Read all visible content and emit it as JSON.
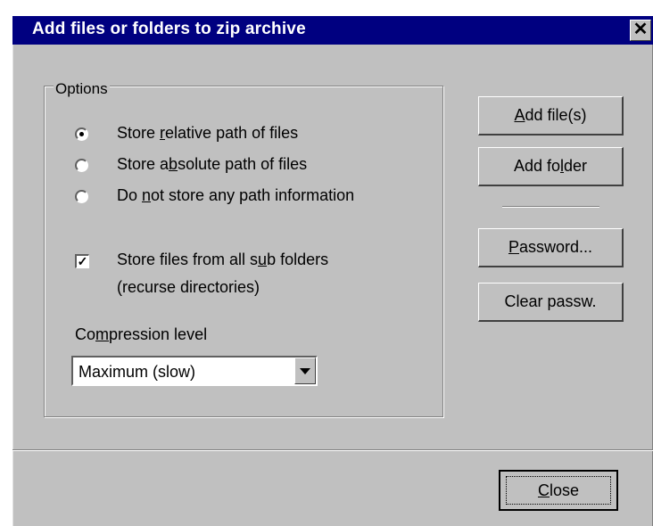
{
  "dialog": {
    "title": "Add files or folders to zip archive",
    "close_glyph": "✕"
  },
  "options": {
    "group_label": "Options",
    "radios": [
      {
        "pre": "Store ",
        "ul": "r",
        "post": "elative path of files",
        "selected": true
      },
      {
        "pre": "Store a",
        "ul": "b",
        "post": "solute path of files",
        "selected": false
      },
      {
        "pre": "Do ",
        "ul": "n",
        "post": "ot store any path information",
        "selected": false
      }
    ],
    "subfolders_checkbox": {
      "line1_pre": "Store files from all s",
      "line1_ul": "u",
      "line1_post": "b folders",
      "line2": "(recurse directories)",
      "checked": true,
      "check_glyph": "✓"
    },
    "compression": {
      "label_pre": "Co",
      "label_ul": "m",
      "label_post": "pression level",
      "selected_value": "Maximum (slow)"
    }
  },
  "buttons": {
    "add_files": {
      "ul": "A",
      "post": "dd file(s)",
      "pre": ""
    },
    "add_folder": {
      "pre": "Add fo",
      "ul": "l",
      "post": "der"
    },
    "password": {
      "pre": "",
      "ul": "P",
      "post": "assword..."
    },
    "clear_password": {
      "label": "Clear passw."
    },
    "close": {
      "pre": "",
      "ul": "C",
      "post": "lose"
    }
  },
  "colors": {
    "titlebar": "#000080",
    "face": "#c0c0c0"
  }
}
